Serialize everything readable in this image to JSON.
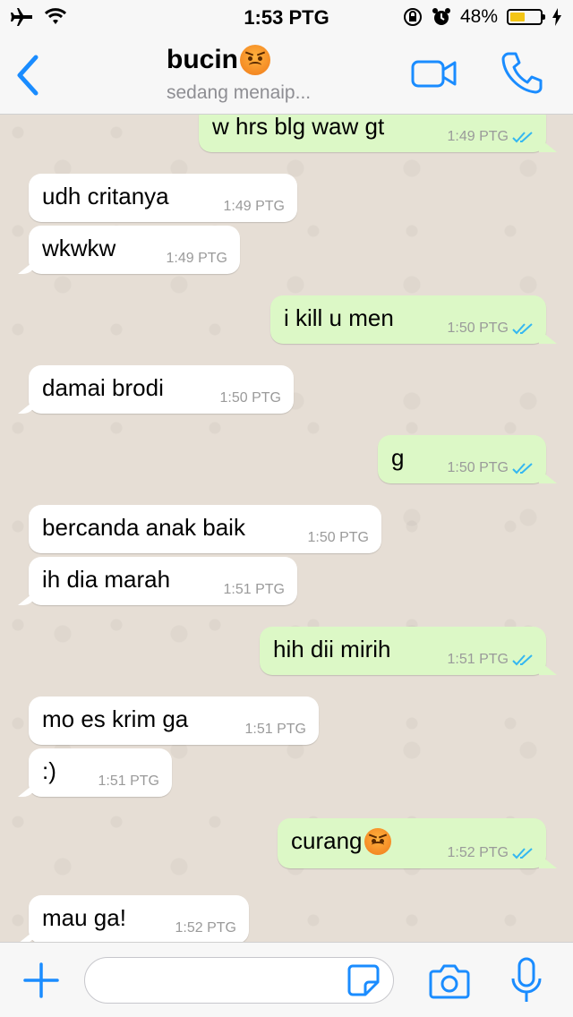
{
  "status_bar": {
    "time": "1:53 PTG",
    "battery_percent": "48%",
    "battery_level": 0.48,
    "icons": [
      "airplane-icon",
      "wifi-icon",
      "orientation-lock-icon",
      "alarm-icon",
      "battery-icon",
      "charging-icon"
    ]
  },
  "header": {
    "back_icon": "chevron-left-icon",
    "contact_name": "bucin",
    "contact_emoji": "angry-face-emoji",
    "status": "sedang menaip...",
    "video_icon": "video-call-icon",
    "call_icon": "phone-icon",
    "accent_color": "#1a8cff"
  },
  "messages": [
    {
      "dir": "out",
      "text": "w hrs blg waw gt",
      "time": "1:49 PTG",
      "ticks": "read"
    },
    {
      "dir": "in",
      "text": "udh critanya",
      "time": "1:49 PTG"
    },
    {
      "dir": "in",
      "text": "wkwkw",
      "time": "1:49 PTG"
    },
    {
      "dir": "out",
      "text": "i kill u men",
      "time": "1:50 PTG",
      "ticks": "read"
    },
    {
      "dir": "in",
      "text": "damai brodi",
      "time": "1:50 PTG"
    },
    {
      "dir": "out",
      "text": "g",
      "time": "1:50 PTG",
      "ticks": "read"
    },
    {
      "dir": "in",
      "text": "bercanda anak baik",
      "time": "1:50 PTG"
    },
    {
      "dir": "in",
      "text": "ih dia marah",
      "time": "1:51 PTG"
    },
    {
      "dir": "out",
      "text": "hih dii mirih",
      "time": "1:51 PTG",
      "ticks": "read"
    },
    {
      "dir": "in",
      "text": "mo es krim ga",
      "time": "1:51 PTG"
    },
    {
      "dir": "in",
      "text": ":)",
      "time": "1:51 PTG"
    },
    {
      "dir": "out",
      "text": "curang",
      "emoji": "angry-face-emoji",
      "time": "1:52 PTG",
      "ticks": "read"
    },
    {
      "dir": "in",
      "text": "mau ga!",
      "time": "1:52 PTG"
    }
  ],
  "input_bar": {
    "plus_icon": "plus-icon",
    "input_value": "",
    "sticker_icon": "sticker-icon",
    "camera_icon": "camera-icon",
    "mic_icon": "microphone-icon"
  },
  "colors": {
    "incoming_bubble": "#ffffff",
    "outgoing_bubble": "#dcf8c6",
    "read_ticks": "#34b7f1",
    "chat_background": "#e6ded5"
  }
}
